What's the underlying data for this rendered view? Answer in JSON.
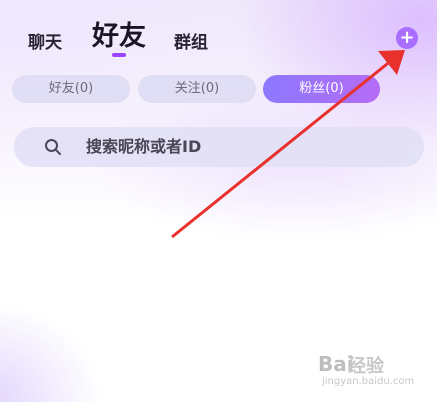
{
  "tabs": {
    "chat": "聊天",
    "friends": "好友",
    "groups": "群组"
  },
  "add_button": "+",
  "chips": {
    "friends": "好友(0)",
    "follow": "关注(0)",
    "fans": "粉丝(0)"
  },
  "search": {
    "placeholder": "搜索昵称或者ID"
  },
  "watermark": {
    "mark": "Bai",
    "text": "经验",
    "url": "jingyan.baidu.com"
  },
  "colors": {
    "accent": "#9b45ff",
    "annotation_arrow": "#e8302c"
  }
}
